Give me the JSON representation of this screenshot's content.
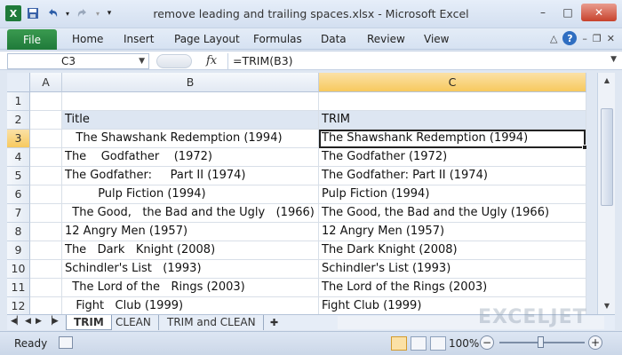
{
  "window": {
    "title": "remove leading and trailing spaces.xlsx - Microsoft Excel",
    "logo": "X",
    "minimize": "–",
    "maximize": "□",
    "close": "✕"
  },
  "ribbon": {
    "file": "File",
    "tabs": [
      "Home",
      "Insert",
      "Page Layout",
      "Formulas",
      "Data",
      "Review",
      "View"
    ]
  },
  "formula_bar": {
    "name_box": "C3",
    "fx": "fx",
    "formula": "=TRIM(B3)"
  },
  "columns": [
    "A",
    "B",
    "C"
  ],
  "selected_column": "C",
  "rows": [
    {
      "num": "1",
      "b": "",
      "c": ""
    },
    {
      "num": "2",
      "b": "Title",
      "c": "TRIM"
    },
    {
      "num": "3",
      "b": "   The Shawshank Redemption (1994)",
      "c": "The Shawshank Redemption (1994)"
    },
    {
      "num": "4",
      "b": "The    Godfather    (1972)",
      "c": "The Godfather (1972)"
    },
    {
      "num": "5",
      "b": "The Godfather:     Part II (1974)",
      "c": "The Godfather: Part II (1974)"
    },
    {
      "num": "6",
      "b": "         Pulp Fiction (1994)",
      "c": "Pulp Fiction (1994)"
    },
    {
      "num": "7",
      "b": "  The Good,   the Bad and the Ugly   (1966)",
      "c": "The Good, the Bad and the Ugly (1966)"
    },
    {
      "num": "8",
      "b": "12 Angry Men (1957)",
      "c": "12 Angry Men (1957)"
    },
    {
      "num": "9",
      "b": "The   Dark   Knight (2008)",
      "c": "The Dark Knight (2008)"
    },
    {
      "num": "10",
      "b": "Schindler's List   (1993)",
      "c": "Schindler's List (1993)"
    },
    {
      "num": "11",
      "b": "  The Lord of the   Rings (2003)",
      "c": "The Lord of the Rings (2003)"
    },
    {
      "num": "12",
      "b": "   Fight   Club (1999)",
      "c": "Fight Club (1999)"
    }
  ],
  "active_cell": "C3",
  "sheets": [
    "TRIM",
    "CLEAN",
    "TRIM and CLEAN"
  ],
  "active_sheet": "TRIM",
  "watermark": "EXCELJET",
  "status": {
    "ready": "Ready",
    "zoom": "100%"
  },
  "colors": {
    "file_tab": "#1f7a3a",
    "selected_header": "#f7c95e",
    "table_header_fill": "#dde6f2"
  }
}
